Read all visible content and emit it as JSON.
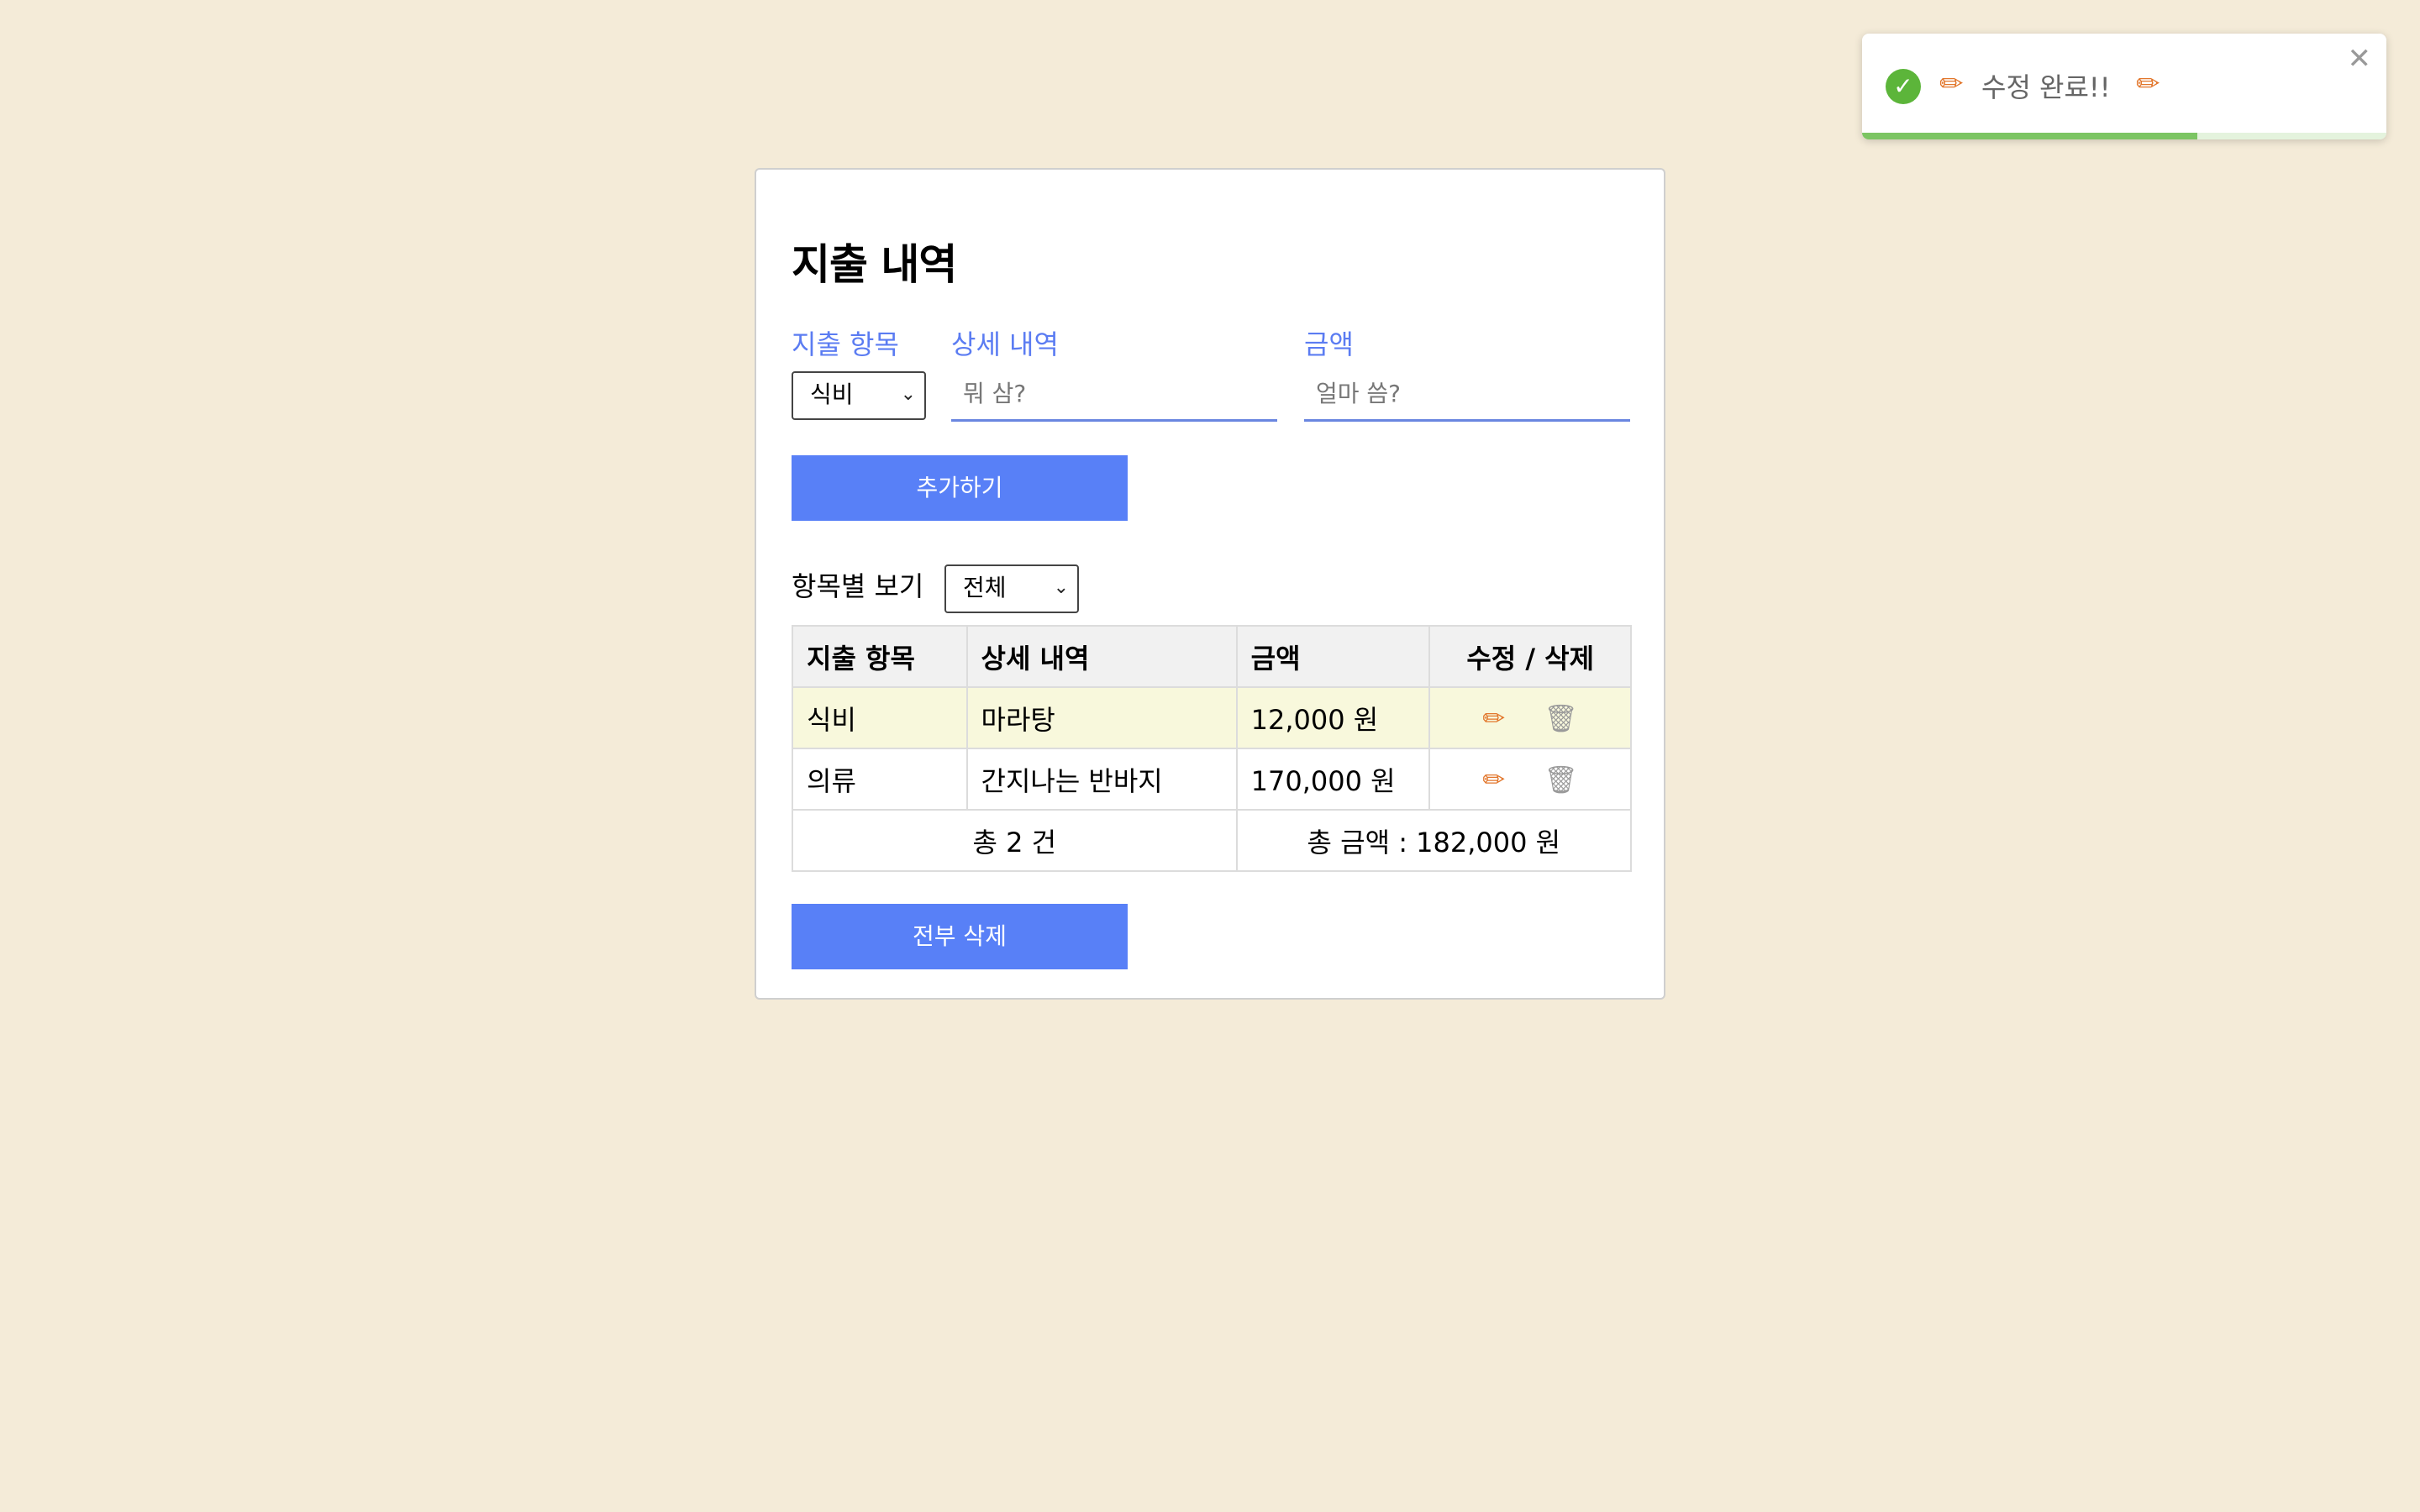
{
  "panel": {
    "title": "지출 내역",
    "form": {
      "category_label": "지출 항목",
      "category_value": "식비",
      "detail_label": "상세 내역",
      "detail_placeholder": "뭐 삼?",
      "amount_label": "금액",
      "amount_placeholder": "얼마 씀?",
      "add_button": "추가하기"
    },
    "filter": {
      "label": "항목별 보기",
      "value": "전체"
    },
    "table": {
      "headers": [
        "지출 항목",
        "상세 내역",
        "금액",
        "수정 / 삭제"
      ],
      "rows": [
        {
          "category": "식비",
          "detail": "마라탕",
          "amount": "12,000 원"
        },
        {
          "category": "의류",
          "detail": "간지나는 반바지",
          "amount": "170,000 원"
        }
      ],
      "footer": {
        "count": "총 2 건",
        "total": "총 금액 : 182,000 원"
      }
    },
    "delete_all_button": "전부 삭제"
  },
  "toast": {
    "message": "수정 완료!!",
    "progress": 0.64,
    "accent_color": "#5cb53a"
  },
  "icons": {
    "edit": "pencil-icon",
    "delete": "trash-icon",
    "success": "check-circle-icon",
    "close": "close-icon",
    "dropdown": "chevron-down-icon"
  }
}
